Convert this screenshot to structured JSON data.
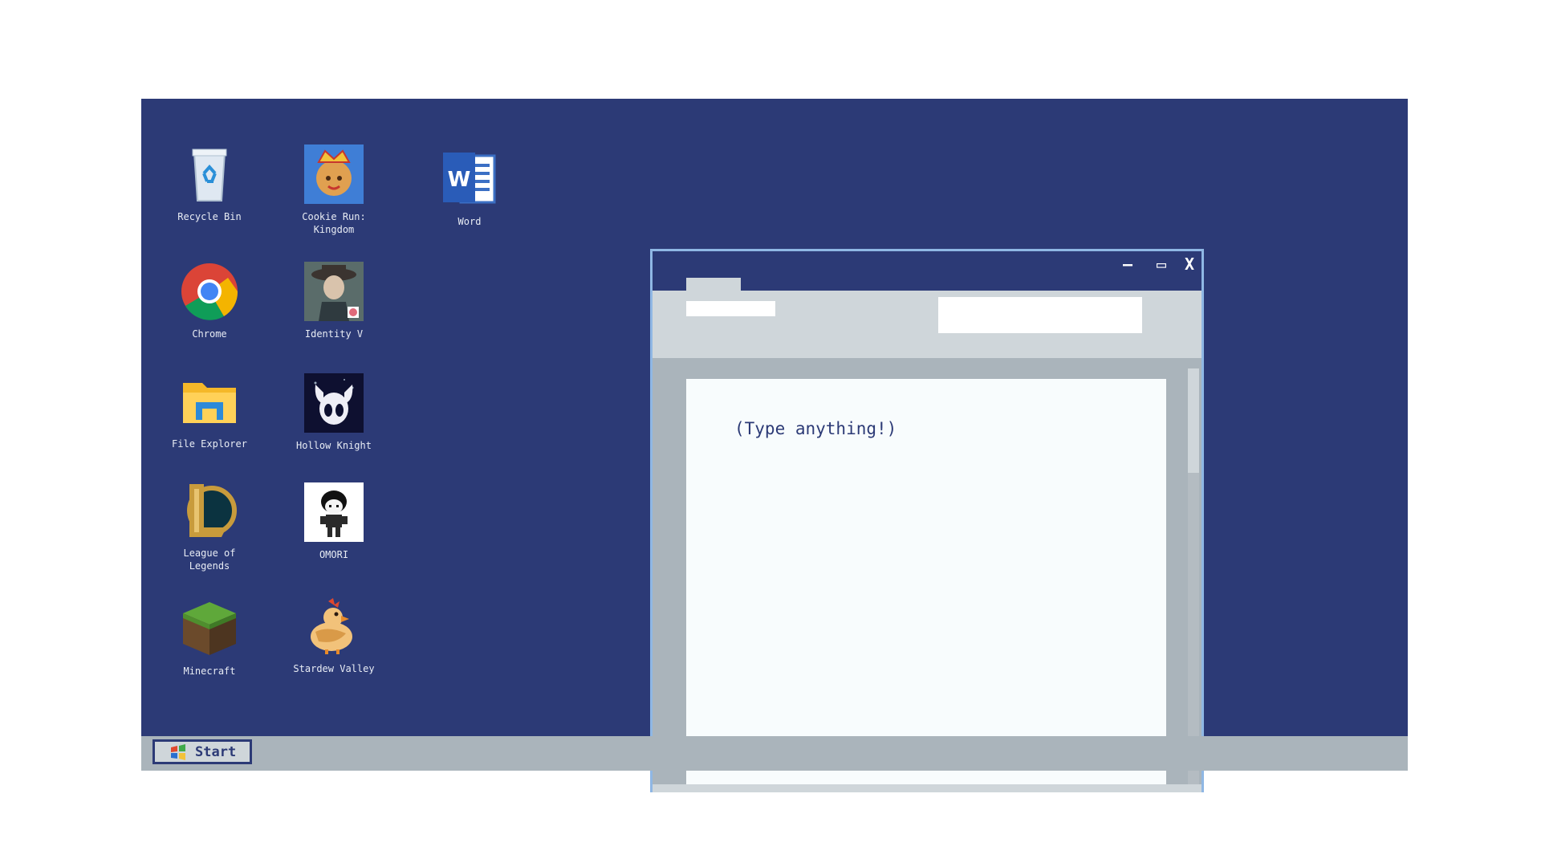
{
  "desktop": {
    "background": "#2c3a76",
    "icons": [
      {
        "label": "Recycle Bin",
        "icon": "recycle-bin-icon"
      },
      {
        "label": "Cookie Run:\nKingdom",
        "icon": "cookie-run-kingdom-icon"
      },
      {
        "label": "Word",
        "icon": "word-icon"
      },
      {
        "label": "Chrome",
        "icon": "chrome-icon"
      },
      {
        "label": "Identity V",
        "icon": "identity-v-icon"
      },
      {
        "label": "File Explorer",
        "icon": "file-explorer-icon"
      },
      {
        "label": "Hollow Knight",
        "icon": "hollow-knight-icon"
      },
      {
        "label": "League of\nLegends",
        "icon": "league-of-legends-icon"
      },
      {
        "label": "OMORI",
        "icon": "omori-icon"
      },
      {
        "label": "Minecraft",
        "icon": "minecraft-icon"
      },
      {
        "label": "Stardew Valley",
        "icon": "stardew-valley-icon"
      }
    ]
  },
  "window": {
    "minimize": "—",
    "maximize": "▭",
    "close": "X",
    "document_text": "(Type anything!)",
    "border_color": "#8fb7e4"
  },
  "taskbar": {
    "start_label": "Start",
    "background": "#aab4bb"
  }
}
